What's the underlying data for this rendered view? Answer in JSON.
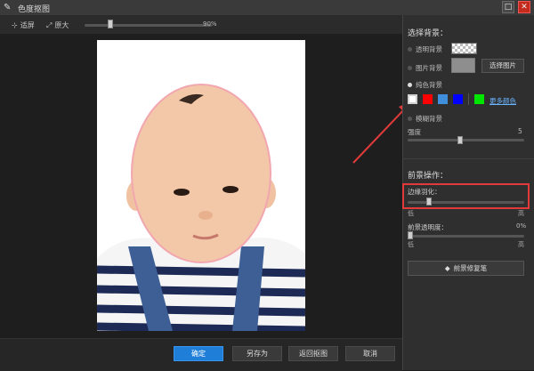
{
  "window": {
    "title": "色度抠图",
    "minimize_symbol": "□",
    "close_symbol": "✕"
  },
  "toolbar": {
    "fit_label": "适屏",
    "original_label": "原大",
    "zoom_value": "90%",
    "zoom_level": 90
  },
  "panel": {
    "bg_title": "选择背景：",
    "transparent_bg": "透明背景",
    "image_bg": "图片背景",
    "choose_image": "选择图片",
    "solid_bg": "纯色背景",
    "swatches": [
      "#ffffff",
      "#ff0000",
      "#3f8fdc",
      "#0000ff",
      "#00e600"
    ],
    "more_colors": "更多颜色",
    "blur_bg": "模糊背景",
    "strength_label": "强度",
    "strength_value": "5",
    "fg_title": "前景操作：",
    "edge_feather": "边缘羽化：",
    "low": "低",
    "high": "高",
    "fg_opacity": "前景透明度：",
    "fg_opacity_value": "0%",
    "fg_repair": "前景修复笔"
  },
  "buttons": {
    "ok": "确定",
    "save_as": "另存为",
    "back": "返回抠图",
    "cancel": "取消"
  },
  "colors": {
    "accent": "#1f7fd8",
    "annotation": "#e03a3a",
    "link": "#6ab4ff"
  }
}
